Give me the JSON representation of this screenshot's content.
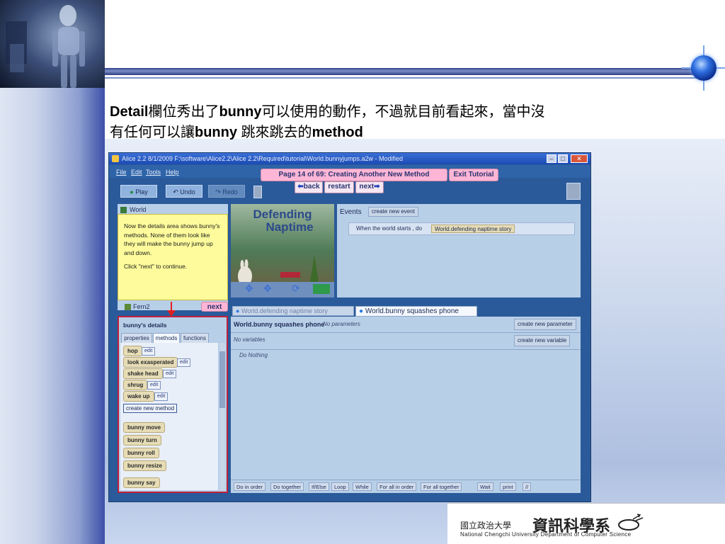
{
  "slide": {
    "title_line1_parts": [
      "Detail",
      "欄位秀出了",
      "bunny",
      "可以使用的動作，不過就目前看起來，當中沒"
    ],
    "title_line2_parts": [
      "有任何可以讓",
      "bunny",
      " 跳來跳去的",
      "method"
    ]
  },
  "app": {
    "window_title": "Alice 2.2 8/1/2009  F:\\software\\Alice2.2\\Alice 2.2\\Required\\tutorial\\World.bunnyjumps.a2w  - Modified",
    "menu": [
      "File",
      "Edit",
      "Tools",
      "Help"
    ],
    "tutorial": {
      "page_label": "Page 14 of 69: Creating Another New Method",
      "exit_label": "Exit Tutorial",
      "back_label": "back",
      "restart_label": "restart",
      "next_label": "next"
    },
    "toolbar": {
      "play_label": "Play",
      "undo_label": "Undo",
      "redo_label": "Redo"
    },
    "object_tree": {
      "world_label": "World",
      "fern_label": "Fern2"
    },
    "callout": {
      "text": "Now the details area shows bunny's methods. None of them look like they will make the bunny jump up and down.",
      "instruction": "Click \"next\" to continue.",
      "next_label": "next"
    },
    "scene": {
      "title_line1": "Defending",
      "title_line2": "Naptime"
    },
    "events": {
      "label": "Events",
      "create_button": "create new event",
      "when_text": "When the world starts , do",
      "do_value": "World.defending naptime story"
    },
    "details": {
      "title": "bunny's details",
      "tabs": [
        "properties",
        "methods",
        "functions"
      ],
      "methods": [
        {
          "name": "hop",
          "edit": "edit"
        },
        {
          "name": "look exasperated",
          "edit": "edit"
        },
        {
          "name": "shake head",
          "edit": "edit"
        },
        {
          "name": "shrug",
          "edit": "edit"
        },
        {
          "name": "wake up",
          "edit": "edit"
        }
      ],
      "create_method": "create new method",
      "builtins": [
        "bunny  move",
        "bunny  turn",
        "bunny  roll",
        "bunny  resize",
        "bunny  say"
      ]
    },
    "editor": {
      "tabs": [
        "World.defending naptime story",
        "World.bunny squashes phone"
      ],
      "method_title": "World.bunny squashes phone",
      "no_params": "No parameters",
      "create_param": "create new parameter",
      "no_vars": "No variables",
      "create_var": "create new variable",
      "do_nothing": "Do Nothing"
    },
    "bottom_bar": [
      "Do in order",
      "Do together",
      "If/Else",
      "Loop",
      "While",
      "For all in order",
      "For all together",
      "Wait",
      "print",
      "//"
    ]
  },
  "footer": {
    "school_cn": "國立政治大學",
    "dept_cn": "資訊科學系",
    "dept_en": "National Chengchi University Department of Computer Science"
  }
}
